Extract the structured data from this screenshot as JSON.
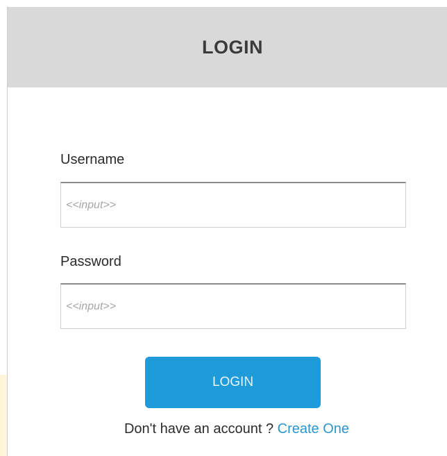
{
  "header": {
    "title": "LOGIN"
  },
  "form": {
    "username_label": "Username",
    "username_placeholder": "<<input>>",
    "password_label": "Password",
    "password_placeholder": "<<input>>",
    "login_button_label": "LOGIN"
  },
  "footer": {
    "prompt_text": "Don't have an account ?",
    "create_link_label": "Create One"
  },
  "colors": {
    "header_background": "#d9d9d9",
    "button_background": "#1e9bd8",
    "link": "#2b95cc"
  }
}
